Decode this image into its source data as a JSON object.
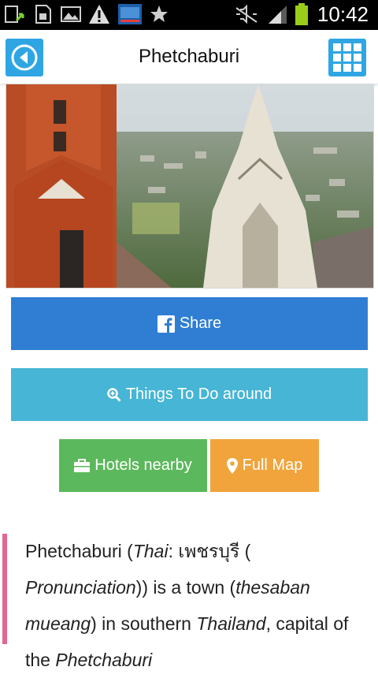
{
  "status_bar": {
    "time": "10:42",
    "icons": [
      "upload-icon",
      "sd-card-icon",
      "gallery-icon",
      "warning-icon",
      "app-thumbnail-icon",
      "star-icon",
      "mute-icon",
      "signal-icon",
      "battery-icon"
    ],
    "battery_color": "#9ccc1a"
  },
  "app_bar": {
    "title": "Phetchaburi",
    "back_icon": "back-arrow-icon",
    "grid_icon": "grid-menu-icon",
    "accent": "#2fa6e3"
  },
  "buttons": {
    "share": "Share",
    "things_to_do": "Things To Do around",
    "hotels": "Hotels nearby",
    "full_map": "Full Map"
  },
  "colors": {
    "share": "#2f7ed3",
    "things_to_do": "#47b5d5",
    "hotels": "#5cb85c",
    "full_map": "#f0a43b",
    "quote_bar": "#e3678f"
  },
  "description": {
    "t1": "Phetchaburi (",
    "i1": "Thai",
    "t2": ": ",
    "thai": "เพชรบุรี",
    "t3": " ( ",
    "i2": "Pronunciation",
    "t4": ")) is a town (",
    "i3": "thesaban mueang",
    "t5": ") in southern ",
    "i4": "Thailand",
    "t6": ", capital of the ",
    "i5": "Phetchaburi"
  }
}
